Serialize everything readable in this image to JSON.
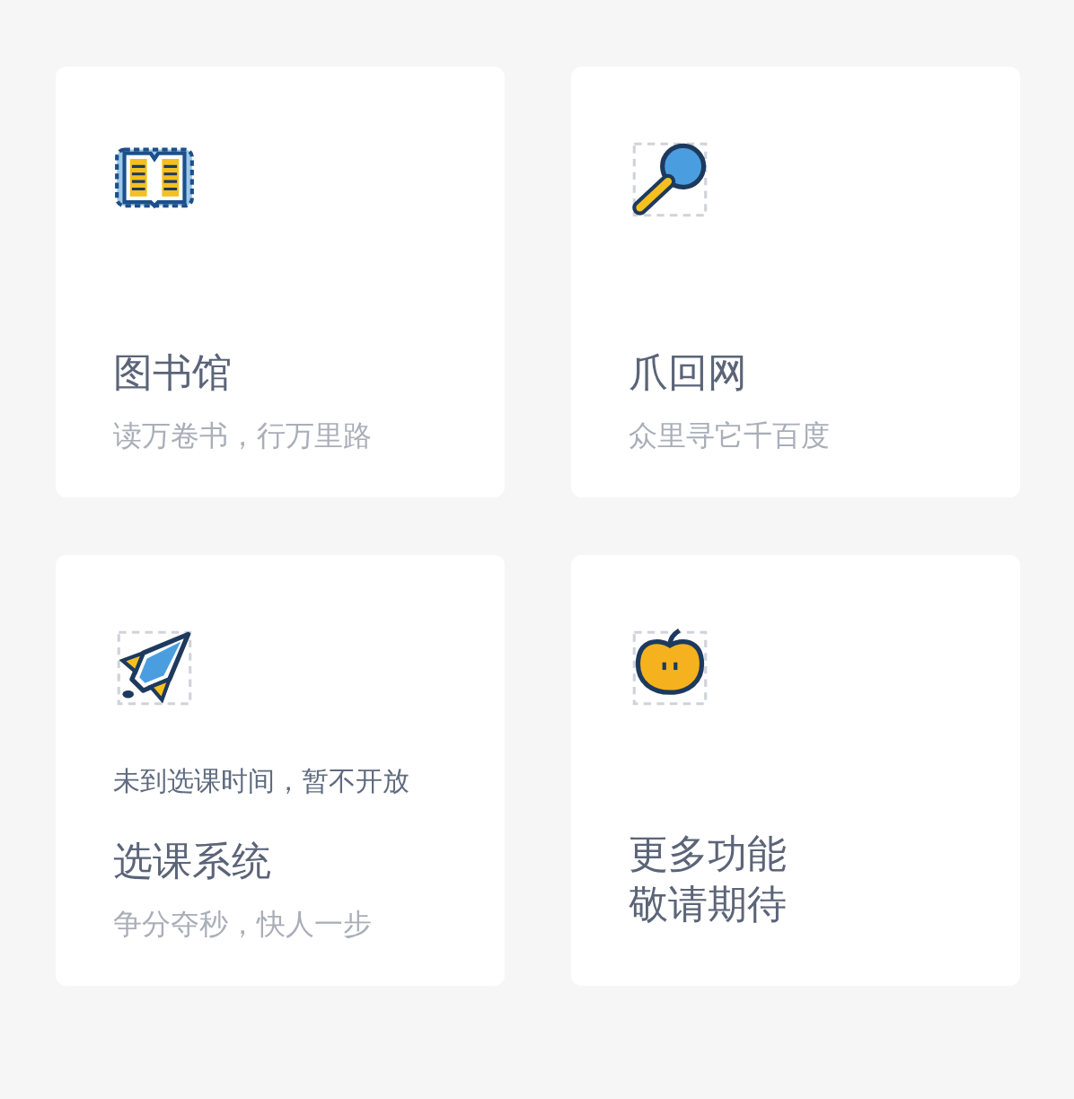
{
  "cards": [
    {
      "kind": "book",
      "title": "图书馆",
      "subtitle": "读万卷书，行万里路"
    },
    {
      "kind": "magnifier",
      "title": "爪回网",
      "subtitle": "众里寻它千百度"
    },
    {
      "kind": "rocket",
      "notice": "未到选课时间，暂不开放",
      "title": "选课系统",
      "subtitle": "争分夺秒，快人一步"
    },
    {
      "kind": "apple",
      "title_lines": [
        "更多功能",
        "敬请期待"
      ]
    }
  ]
}
